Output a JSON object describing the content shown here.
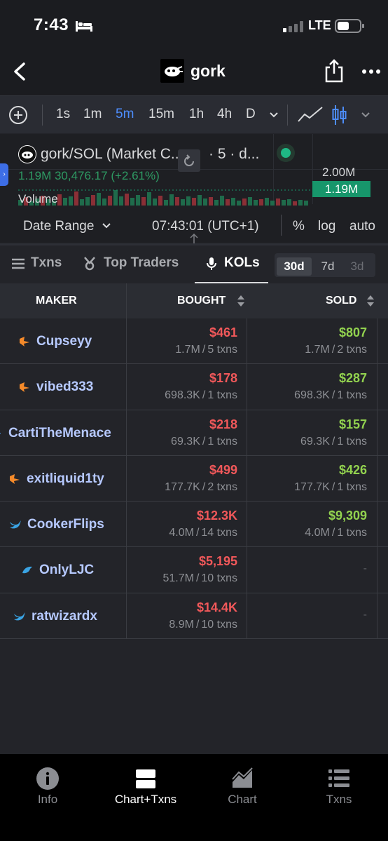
{
  "status_bar": {
    "time": "7:43",
    "network": "LTE"
  },
  "header": {
    "token_name": "gork"
  },
  "toolbar": {
    "timeframes": [
      "1s",
      "1m",
      "5m",
      "15m",
      "1h",
      "4h",
      "D"
    ],
    "active_timeframe": "5m"
  },
  "chart": {
    "pair_title": "gork/SOL (Market C...",
    "pair_suffix": "· 5 · d...",
    "price_text": "1.19M  30,476.17 (+2.61%)",
    "volume_label": "Volume",
    "axis_top": "2.00M",
    "axis_current": "1.19M",
    "date_range": "Date Range",
    "clock": "07:43:01 (UTC+1)",
    "options": [
      "%",
      "log",
      "auto"
    ]
  },
  "tabs": {
    "items": [
      "Txns",
      "Top Traders",
      "KOLs"
    ],
    "active": "KOLs",
    "periods": [
      "30d",
      "7d",
      "3d"
    ],
    "active_period": "30d"
  },
  "table": {
    "headers": {
      "maker": "MAKER",
      "bought": "BOUGHT",
      "sold": "SOLD"
    },
    "rows": [
      {
        "maker": "Cupseyy",
        "icon": "bird-icon",
        "bought_usd": "$461",
        "bought_tokens": "1.7M",
        "bought_txns": "5 txns",
        "sold_usd": "$807",
        "sold_tokens": "1.7M",
        "sold_txns": "2 txns"
      },
      {
        "maker": "vibed333",
        "icon": "bird-icon",
        "bought_usd": "$178",
        "bought_tokens": "698.3K",
        "bought_txns": "1 txns",
        "sold_usd": "$287",
        "sold_tokens": "698.3K",
        "sold_txns": "1 txns"
      },
      {
        "maker": "CartiTheMenace",
        "icon": "diamond-icon",
        "bought_usd": "$218",
        "bought_tokens": "69.3K",
        "bought_txns": "1 txns",
        "sold_usd": "$157",
        "sold_tokens": "69.3K",
        "sold_txns": "1 txns"
      },
      {
        "maker": "exitliquid1ty",
        "icon": "bird-icon",
        "bought_usd": "$499",
        "bought_tokens": "177.7K",
        "bought_txns": "2 txns",
        "sold_usd": "$426",
        "sold_tokens": "177.7K",
        "sold_txns": "1 txns"
      },
      {
        "maker": "CookerFlips",
        "icon": "twitter-bird-icon",
        "bought_usd": "$12.3K",
        "bought_tokens": "4.0M",
        "bought_txns": "14 txns",
        "sold_usd": "$9,309",
        "sold_tokens": "4.0M",
        "sold_txns": "1 txns"
      },
      {
        "maker": "OnlyLJC",
        "icon": "dolphin-icon",
        "bought_usd": "$5,195",
        "bought_tokens": "51.7M",
        "bought_txns": "10 txns",
        "sold_usd": "",
        "sold_tokens": "",
        "sold_txns": "",
        "sold_dash": "-"
      },
      {
        "maker": "ratwizardx",
        "icon": "twitter-bird-icon",
        "bought_usd": "$14.4K",
        "bought_tokens": "8.9M",
        "bought_txns": "10 txns",
        "sold_usd": "",
        "sold_tokens": "",
        "sold_txns": "",
        "sold_dash": "-"
      }
    ]
  },
  "bottom_nav": {
    "items": [
      "Info",
      "Chart+Txns",
      "Chart",
      "Txns"
    ],
    "active": "Chart+Txns"
  },
  "colors": {
    "accent": "#4d8dfc",
    "bought": "#f1585a",
    "sold": "#92d24f",
    "maker_link": "#b6c9ff",
    "price_up": "#17966b"
  }
}
